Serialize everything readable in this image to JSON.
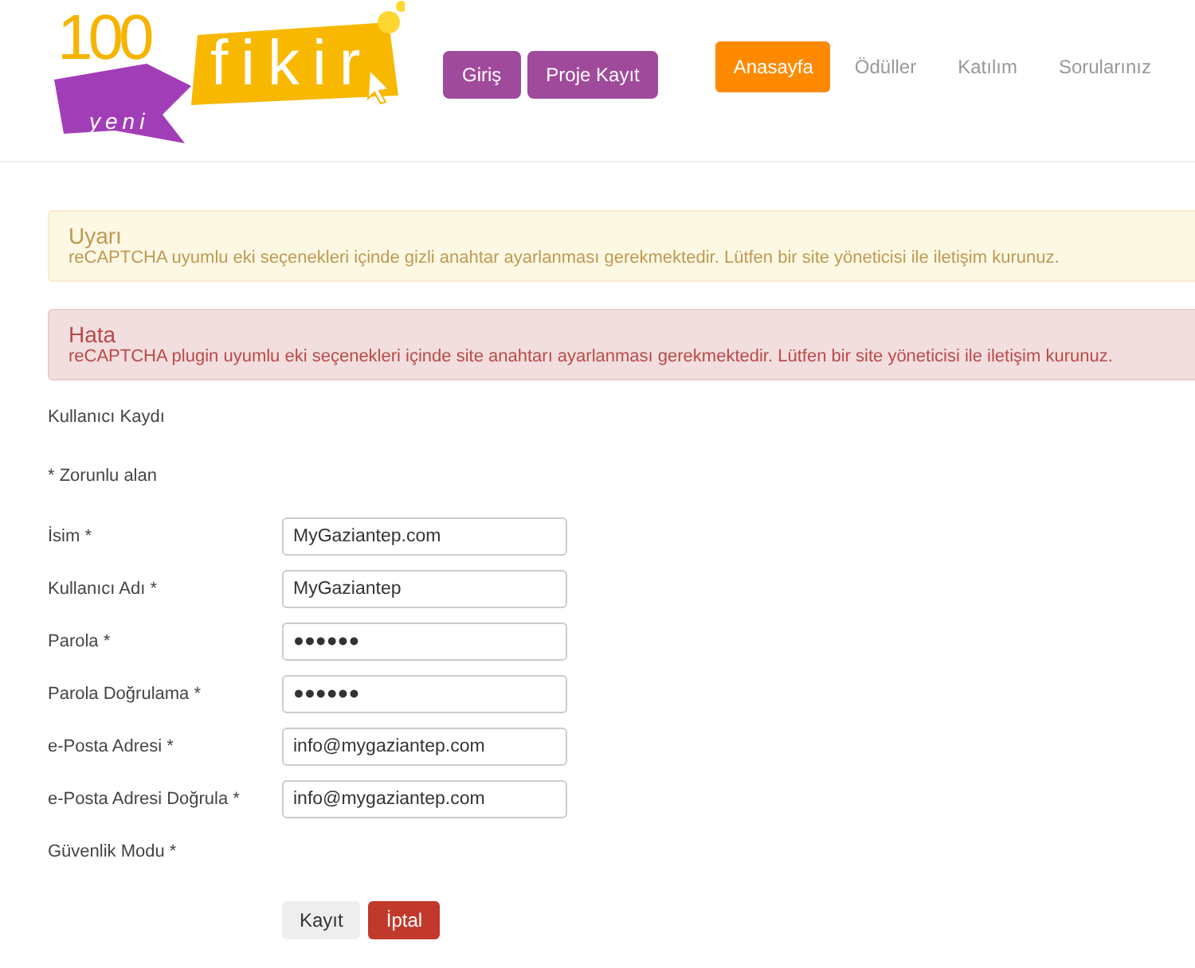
{
  "logo": {
    "number": "100",
    "word": "fikir",
    "ribbon": "yeni"
  },
  "header_buttons": [
    "Giriş",
    "Proje Kayıt"
  ],
  "nav": [
    {
      "label": "Anasayfa",
      "selected": true
    },
    {
      "label": "Ödüller",
      "selected": false
    },
    {
      "label": "Katılım",
      "selected": false
    },
    {
      "label": "Sorularınız",
      "selected": false
    }
  ],
  "alerts": [
    {
      "kind": "warning",
      "title": "Uyarı",
      "message": "reCAPTCHA uyumlu eki seçenekleri içinde gizli anahtar ayarlanması gerekmektedir. Lütfen bir site yöneticisi ile iletişim kurunuz."
    },
    {
      "kind": "error",
      "title": "Hata",
      "message": "reCAPTCHA plugin uyumlu eki seçenekleri içinde site anahtarı ayarlanması gerekmektedir. Lütfen bir site yöneticisi ile iletişim kurunuz."
    }
  ],
  "form": {
    "title": "Kullanıcı Kaydı",
    "required_note": "* Zorunlu alan",
    "fields": [
      {
        "label": "İsim *",
        "value": "MyGaziantep.com"
      },
      {
        "label": "Kullanıcı Adı *",
        "value": "MyGaziantep"
      },
      {
        "label": "Parola *",
        "value": "●●●●●●"
      },
      {
        "label": "Parola Doğrulama *",
        "value": "●●●●●●"
      },
      {
        "label": "e-Posta Adresi *",
        "value": "info@mygaziantep.com"
      },
      {
        "label": "e-Posta Adresi Doğrula *",
        "value": "info@mygaziantep.com"
      },
      {
        "label": "Güvenlik Modu *"
      }
    ],
    "buttons": [
      {
        "label": "Kayıt",
        "kind": "default"
      },
      {
        "label": "İptal",
        "kind": "danger"
      }
    ]
  }
}
